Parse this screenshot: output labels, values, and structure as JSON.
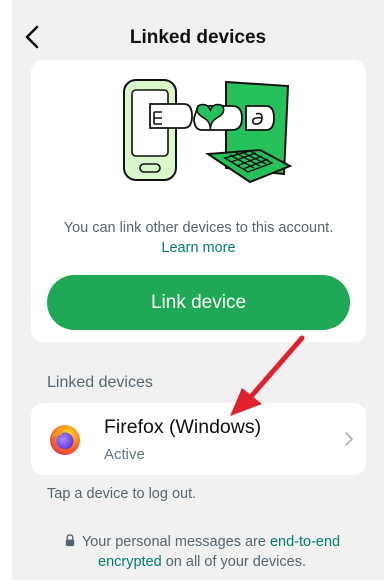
{
  "header": {
    "title": "Linked devices",
    "back_icon": "chevron-left-icon"
  },
  "hero": {
    "description": "You can link other devices to this account.",
    "learn_more": "Learn more",
    "button_label": "Link device"
  },
  "devices_section": {
    "label": "Linked devices",
    "devices": [
      {
        "name": "Firefox (Windows)",
        "status": "Active",
        "icon": "firefox-icon"
      }
    ],
    "hint": "Tap a device to log out."
  },
  "footer": {
    "before": "Your personal messages are ",
    "link": "end-to-end encrypted",
    "after": " on all of your devices."
  },
  "colors": {
    "accent": "#1fa855",
    "link": "#008069",
    "background": "#f1f1f1",
    "annotation_arrow": "#e0202a"
  }
}
